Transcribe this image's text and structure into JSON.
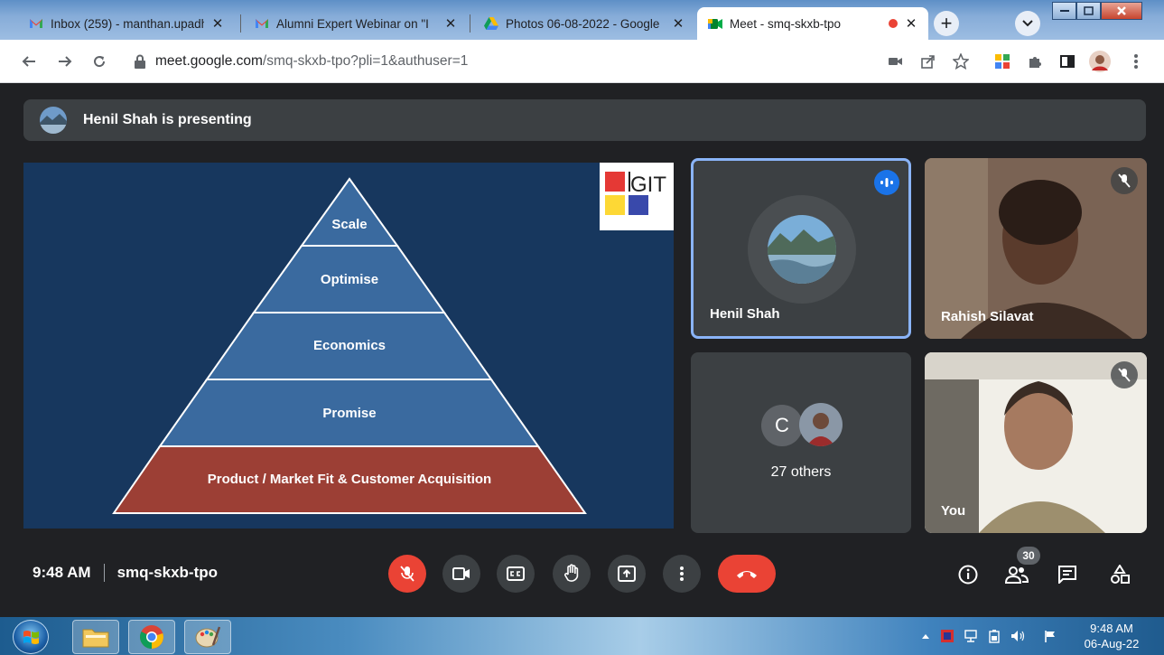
{
  "browser": {
    "tabs": [
      {
        "title": "Inbox (259) - manthan.upadh",
        "favicon": "gmail-icon"
      },
      {
        "title": "Alumni Expert Webinar on \"I",
        "favicon": "gmail-icon"
      },
      {
        "title": "Photos 06-08-2022 - Google",
        "favicon": "drive-icon"
      },
      {
        "title": "Meet - smq-skxb-tpo",
        "favicon": "meet-icon"
      }
    ],
    "url_host": "meet.google.com",
    "url_path": "/smq-skxb-tpo?pli=1&authuser=1",
    "new_tab_label": "+",
    "close_glyph": "✕"
  },
  "meet": {
    "presenting_text": "Henil Shah is presenting",
    "slide": {
      "levels": [
        "Scale",
        "Optimise",
        "Economics",
        "Promise",
        "Product / Market Fit & Customer Acquisition"
      ],
      "logo_text": "GIT"
    },
    "participants": [
      {
        "name": "Henil Shah",
        "state": "speaking"
      },
      {
        "name": "Rahish Silavat",
        "state": "muted"
      },
      {
        "name": "27 others",
        "avatar_letter": "C"
      },
      {
        "name": "You",
        "state": "muted"
      }
    ],
    "time": "9:48 AM",
    "meeting_code": "smq-skxb-tpo",
    "people_count": "30",
    "colors": {
      "accent": "#8ab4f8",
      "danger": "#ea4335",
      "surface": "#3c4043",
      "slide_bg": "#17375e",
      "pyramid_blue": "#3a6a9f",
      "pyramid_red": "#9c3f35"
    }
  },
  "taskbar": {
    "time": "9:48 AM",
    "date": "06-Aug-22"
  }
}
